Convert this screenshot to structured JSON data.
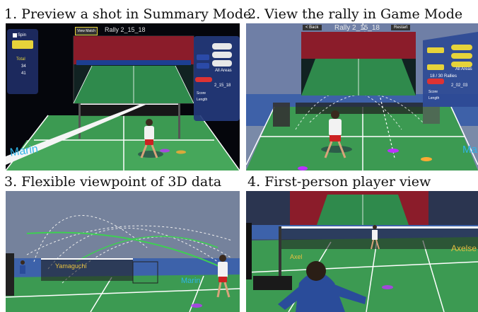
{
  "captions": {
    "p1": "1. Preview a shot in Summary Mode",
    "p2": "2. View the rally in Game Mode",
    "p3": "3. Flexible viewpoint of 3D data",
    "p4": "4. First-person player view"
  },
  "panel1": {
    "view_match_button": "View Match",
    "rally_title": "Rally 2_15_18",
    "spin_label": "Spin",
    "total_label": "Total",
    "stat_a": "34",
    "stat_b": "41",
    "all_areas": "All Areas",
    "rally_code": "2_15_18",
    "score_label": "Score",
    "length_label": "Length",
    "court_text": "Marin"
  },
  "panel2": {
    "back_button": "< Back",
    "rally_title": "Rally 2_15_18",
    "restart_button": "Restart",
    "all_areas": "All Areas",
    "rallies_label": "18 / 30 Rallies",
    "rally_code": "2_02_03",
    "score_label": "Score",
    "length_label": "Length",
    "court_text": "Marin"
  },
  "panel3": {
    "net_text": "Yamaguchi",
    "court_text": "Marin"
  },
  "panel4": {
    "court_text_left": "Axel",
    "court_text_right": "Axelse"
  },
  "colors": {
    "court_green": "#3c9a52",
    "court_light": "#56b765",
    "arena_blue": "#3a4f7e",
    "ui_panel": "#2a3f7a",
    "accent_red": "#d33",
    "highlight_yellow": "#e6d33a"
  }
}
